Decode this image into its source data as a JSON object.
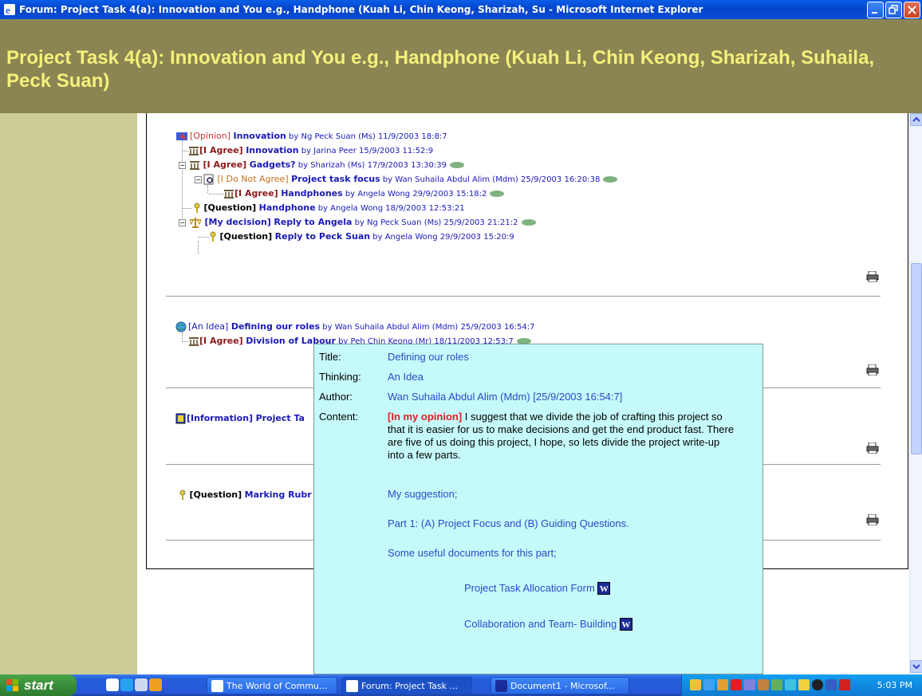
{
  "window": {
    "title": "Forum: Project Task 4(a): Innovation and You e.g., Handphone (Kuah Li, Chin Keong, Sharizah, Su - Microsoft Internet Explorer"
  },
  "forum": {
    "heading": "Project Task 4(a): Innovation and You e.g., Handphone (Kuah Li, Chin Keong, Sharizah, Suhaila, Peck Suan)"
  },
  "threads": [
    {
      "posts": [
        {
          "tag": "[Opinion]",
          "subject": "Innovation",
          "meta": " by Ng Peck Suan (Ms) 11/9/2003 18:8:7"
        },
        {
          "tag": "[I Agree]",
          "subject": "Innovation",
          "meta": " by Jarina Peer 15/9/2003 11:52:9"
        },
        {
          "tag": "[I Agree]",
          "subject": "Gadgets?",
          "meta": " by Sharizah (Ms) 17/9/2003 13:30:39"
        },
        {
          "tag": "[I Do Not Agree]",
          "subject": "Project task focus",
          "meta": " by Wan Suhaila Abdul Alim (Mdm) 25/9/2003 16:20:38"
        },
        {
          "tag": "[I Agree]",
          "subject": "Handphones",
          "meta": " by Angela Wong 29/9/2003 15:18:2"
        },
        {
          "tag": "[Question]",
          "subject": "Handphone",
          "meta": " by Angela Wong 18/9/2003 12:53:21"
        },
        {
          "tag": "[My decision]",
          "subject": "Reply to Angela",
          "meta": " by Ng Peck Suan (Ms) 25/9/2003 21:21:2"
        },
        {
          "tag": "[Question]",
          "subject": "Reply to Peck Suan",
          "meta": " by Angela Wong 29/9/2003 15:20:9"
        }
      ]
    },
    {
      "posts": [
        {
          "tag": "[An Idea]",
          "subject": "Defining our roles",
          "meta": " by Wan Suhaila Abdul Alim (Mdm) 25/9/2003 16:54:7"
        },
        {
          "tag": "[I Agree]",
          "subject": "Division of Labour",
          "meta": " by Peh Chin Keong (Mr) 18/11/2003 12:53:7"
        }
      ]
    },
    {
      "posts": [
        {
          "tag": "[Information]",
          "subject": "Project Ta"
        }
      ]
    },
    {
      "posts": [
        {
          "tag": "[Question]",
          "subject": "Marking Rubr"
        }
      ]
    }
  ],
  "popup": {
    "title_label": "Title:",
    "title_value": "Defining our roles",
    "thinking_label": "Thinking:",
    "thinking_value": "An Idea",
    "author_label": "Author:",
    "author_value": "Wan Suhaila Abdul Alim (Mdm) [25/9/2003 16:54:7]",
    "content_label": "Content:",
    "opinion_tag": "[In my opinion]",
    "content_text": " I suggest that we divide the job of crafting this project so that it is easier for us to make decisions and get the end product fast. There are five of us doing this project, I hope, so lets divide the project write-up into a few parts.",
    "suggestion": "My suggestion;",
    "part1": "Part 1: (A) Project Focus and (B) Guiding Questions.",
    "useful_docs": "Some useful documents for this part;",
    "doc1": "Project Task Allocation Form",
    "doc2": "Collaboration and Team- Building",
    "word_icon_letter": "W"
  },
  "taskbar": {
    "start_label": "start",
    "tasks": [
      {
        "label": "The World of Commu..."
      },
      {
        "label": "Forum: Project Task ..."
      },
      {
        "label": "Document1 - Microsof..."
      }
    ],
    "clock": "5:03 PM"
  }
}
